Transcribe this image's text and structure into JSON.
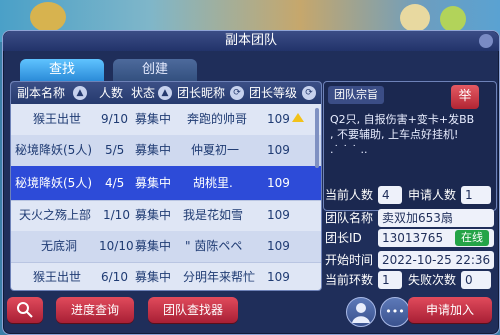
{
  "window": {
    "title": "副本团队"
  },
  "tabs": [
    {
      "label": "查找"
    },
    {
      "label": "创建"
    }
  ],
  "table": {
    "headers": [
      "副本名称",
      "人数",
      "状态",
      "团长昵称",
      "团长等级"
    ],
    "rows": [
      {
        "name": "猴王出世",
        "count": "9/10",
        "status": "募集中",
        "leader": "奔跑的帅哥",
        "level": "109"
      },
      {
        "name": "秘境降妖(5人)",
        "count": "5/5",
        "status": "募集中",
        "leader": "仲夏初一",
        "level": "109"
      },
      {
        "name": "秘境降妖(5人)",
        "count": "4/5",
        "status": "募集中",
        "leader": "胡桃里.",
        "level": "109"
      },
      {
        "name": "天火之殇上部",
        "count": "1/10",
        "status": "募集中",
        "leader": "我是花如雪",
        "level": "109"
      },
      {
        "name": "无底洞",
        "count": "10/10",
        "status": "募集中",
        "leader": "\" 茵陈ペペ",
        "level": "109"
      },
      {
        "name": "猴王出世",
        "count": "6/10",
        "status": "募集中",
        "leader": "分明年来帮忙",
        "level": "109"
      }
    ]
  },
  "declaration": {
    "title": "团队宗旨",
    "report_label": "举",
    "text": "Q2只, 自报伤害+变卡+发BB\n, 不要辅助, 上车点好挂机!\n.˙ ˙ ˙ .."
  },
  "team_info": {
    "current_count_label": "当前人数",
    "current_count": "4",
    "applicants_label": "申请人数",
    "applicants": "1",
    "team_name_label": "团队名称",
    "team_name": "卖双加653扇",
    "leader_id_label": "团长ID",
    "leader_id": "13013765",
    "online_label": "在线",
    "start_time_label": "开始时间",
    "start_time": "2022-10-25 22:36",
    "current_round_label": "当前环数",
    "current_round": "1",
    "fail_count_label": "失败次数",
    "fail_count": "0"
  },
  "bottom": {
    "progress_query": "进度查询",
    "team_finder": "团队查找器",
    "apply_join": "申请加入",
    "more_label": "•••"
  },
  "colors": {
    "accent": "#2d4bd8",
    "button": "#c8313f",
    "online": "#24a447"
  }
}
